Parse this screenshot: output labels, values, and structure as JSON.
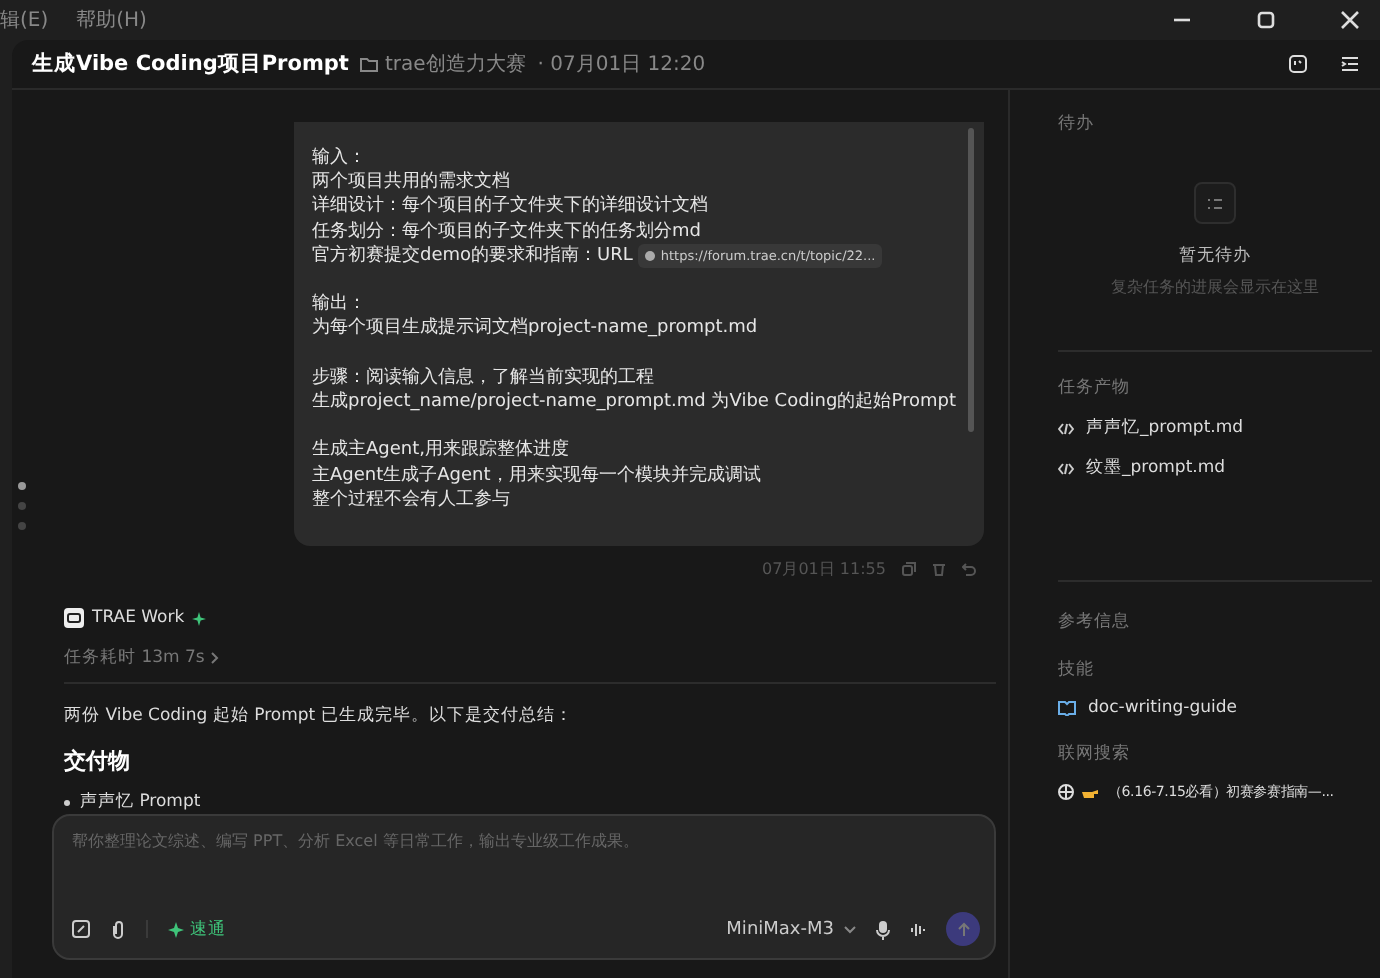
{
  "menu": [
    {
      "label": "辑(E)"
    },
    {
      "label": "帮助(H)"
    }
  ],
  "header": {
    "title": "生成Vibe Coding项目Prompt",
    "folder": "trae创造力大赛",
    "date": "· 07月01日 12:20"
  },
  "pager": [
    {
      "selected": true
    },
    {
      "selected": false
    },
    {
      "selected": false
    }
  ],
  "user_message": {
    "paragraphs": [
      [
        {
          "text": "输入："
        },
        {
          "text": "两个项目共用的需求文档"
        },
        {
          "text": "详细设计：每个项目的子文件夹下的详细设计文档"
        },
        {
          "text": "任务划分：每个项目的子文件夹下的任务划分md"
        },
        {
          "text": "官方初赛提交demo的要求和指南：URL",
          "link": "https://forum.trae.cn/t/topic/22..."
        }
      ],
      [
        {
          "text": "输出："
        },
        {
          "text": "为每个项目生成提示词文档project-name_prompt.md"
        }
      ],
      [
        {
          "text": "步骤：阅读输入信息，了解当前实现的工程"
        },
        {
          "text": "生成project_name/project-name_prompt.md 为Vibe Coding的起始Prompt"
        }
      ],
      [
        {
          "text": "生成主Agent,用来跟踪整体进度"
        },
        {
          "text": "主Agent生成子Agent，用来实现每一个模块并完成调试"
        },
        {
          "text": "整个过程不会有人工参与"
        }
      ]
    ],
    "time": "07月01日 11:55"
  },
  "assistant": {
    "name": "TRAE Work",
    "duration": "任务耗时 13m 7s",
    "summary": "两份 Vibe Coding 起始 Prompt 已生成完毕。以下是交付总结：",
    "heading": "交付物",
    "bullets": [
      "声声忆 Prompt"
    ]
  },
  "composer": {
    "placeholder": "帮你整理论文综述、编写 PPT、分析 Excel 等日常工作，输出专业级工作成果。",
    "mode": "速通",
    "model": "MiniMax-M3"
  },
  "sidebar": {
    "todo": {
      "title": "待办",
      "empty_title": "暂无待办",
      "empty_hint": "复杂任务的进展会显示在这里"
    },
    "outputs": {
      "title": "任务产物",
      "files": [
        "声声忆_prompt.md",
        "纹墨_prompt.md"
      ]
    },
    "references": {
      "title": "参考信息",
      "skills_title": "技能",
      "skills": [
        "doc-writing-guide"
      ],
      "web_title": "联网搜索",
      "web": [
        "（6.16-7.15必看）初赛参赛指南—..."
      ]
    }
  }
}
